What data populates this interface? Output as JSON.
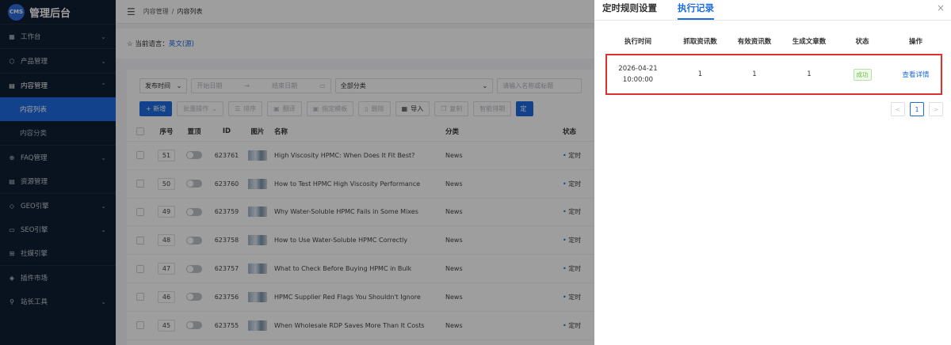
{
  "app": {
    "logo_text": "CMS",
    "title": "管理后台"
  },
  "sidebar": {
    "items": [
      {
        "icon": "dashboard-icon",
        "glyph": "▦",
        "label": "工作台",
        "chevron": "⌄"
      },
      {
        "icon": "product-icon",
        "glyph": "⬡",
        "label": "产品管理",
        "chevron": "⌄"
      },
      {
        "icon": "content-icon",
        "glyph": "▤",
        "label": "内容管理",
        "chevron": "⌃"
      }
    ],
    "sub_items": [
      {
        "label": "内容列表"
      },
      {
        "label": "内容分类"
      }
    ],
    "items2": [
      {
        "icon": "faq-icon",
        "glyph": "⊕",
        "label": "FAQ管理",
        "chevron": "⌄"
      },
      {
        "icon": "resource-icon",
        "glyph": "▤",
        "label": "资源管理",
        "chevron": ""
      },
      {
        "icon": "geo-icon",
        "glyph": "◇",
        "label": "GEO引擎",
        "chevron": "⌄"
      },
      {
        "icon": "seo-icon",
        "glyph": "▭",
        "label": "SEO引擎",
        "chevron": "⌄"
      },
      {
        "icon": "social-icon",
        "glyph": "⊞",
        "label": "社媒引擎",
        "chevron": ""
      },
      {
        "icon": "plugin-icon",
        "glyph": "◈",
        "label": "插件市场",
        "chevron": ""
      },
      {
        "icon": "tools-icon",
        "glyph": "⚲",
        "label": "站长工具",
        "chevron": "⌄"
      }
    ]
  },
  "header": {
    "breadcrumb_root": "内容管理",
    "breadcrumb_sep": "/",
    "breadcrumb_current": "内容列表"
  },
  "lang": {
    "prefix": "☆ 当前语言：",
    "value": "英文(源)"
  },
  "filters": {
    "time_type": "发布时间",
    "start_placeholder": "开始日期",
    "arrow": "→",
    "end_placeholder": "结束日期",
    "category": "全部分类",
    "search_placeholder": "请输入名称或标题"
  },
  "toolbar": {
    "add": "+ 新增",
    "batch": "批量操作",
    "sort": "排序",
    "translate": "翻译",
    "template": "指定模板",
    "delete": "删除",
    "import": "导入",
    "copy": "复制",
    "smart": "智能排期",
    "cut": "定"
  },
  "table": {
    "headers": {
      "seq": "序号",
      "top": "置顶",
      "id": "ID",
      "img": "图片",
      "name": "名称",
      "cat": "分类",
      "status": "状态"
    },
    "rows": [
      {
        "seq": "51",
        "id": "623761",
        "name": "High Viscosity HPMC: When Does It Fit Best?",
        "cat": "News",
        "status": "定时"
      },
      {
        "seq": "50",
        "id": "623760",
        "name": "How to Test HPMC High Viscosity Performance",
        "cat": "News",
        "status": "定时"
      },
      {
        "seq": "49",
        "id": "623759",
        "name": "Why Water-Soluble HPMC Fails in Some Mixes",
        "cat": "News",
        "status": "定时"
      },
      {
        "seq": "48",
        "id": "623758",
        "name": "How to Use Water-Soluble HPMC Correctly",
        "cat": "News",
        "status": "定时"
      },
      {
        "seq": "47",
        "id": "623757",
        "name": "What to Check Before Buying HPMC in Bulk",
        "cat": "News",
        "status": "定时"
      },
      {
        "seq": "46",
        "id": "623756",
        "name": "HPMC Supplier Red Flags You Shouldn't Ignore",
        "cat": "News",
        "status": "定时"
      },
      {
        "seq": "45",
        "id": "623755",
        "name": "When Wholesale RDP Saves More Than It Costs",
        "cat": "News",
        "status": "定时"
      }
    ]
  },
  "panel": {
    "tab_settings": "定时规则设置",
    "tab_records": "执行记录",
    "close": "×",
    "headers": {
      "time": "执行时间",
      "fetched": "抓取资讯数",
      "valid": "有效资讯数",
      "generated": "生成文章数",
      "status": "状态",
      "action": "操作"
    },
    "record": {
      "date": "2026-04-21",
      "time": "10:00:00",
      "fetched": "1",
      "valid": "1",
      "generated": "1",
      "status": "成功",
      "action": "查看详情"
    },
    "pager": {
      "prev": "<",
      "page": "1",
      "next": ">"
    }
  }
}
